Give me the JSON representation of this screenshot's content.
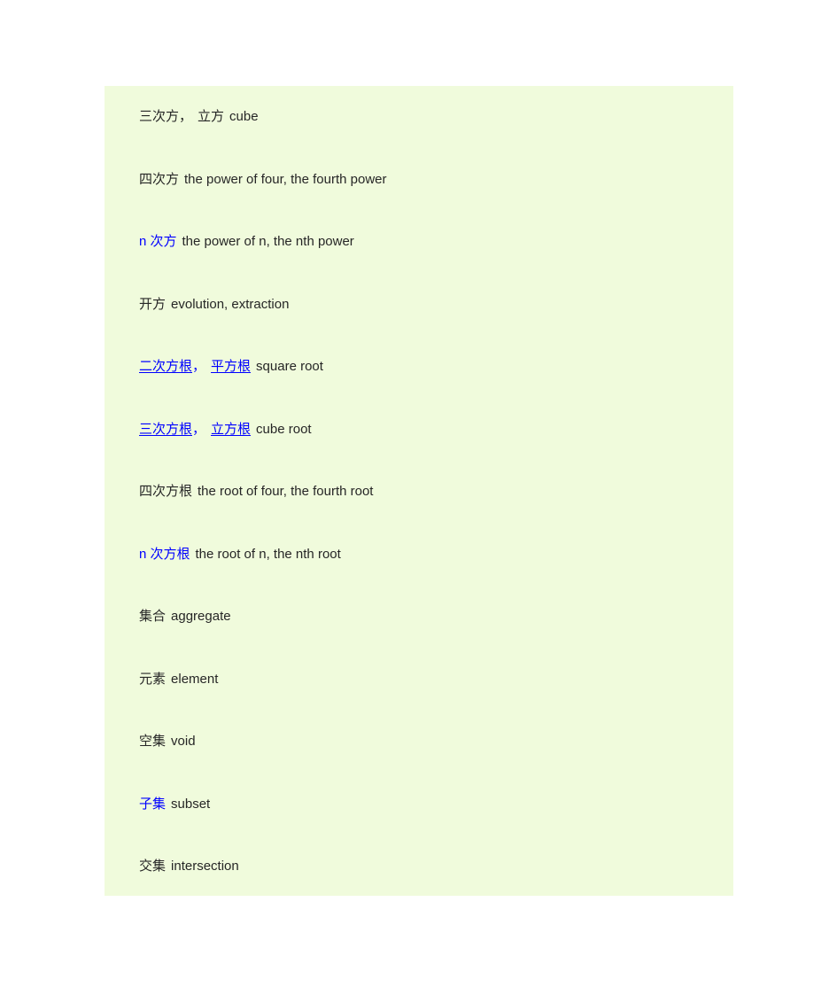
{
  "page": {
    "background_color": "#ffffff",
    "panel_background_color": "#f0fbdc",
    "text_color": "#262626",
    "link_color": "#0000ff"
  },
  "entries": [
    {
      "terms": [
        {
          "text": "三次方",
          "style": "plain"
        },
        {
          "text": "立方",
          "style": "plain"
        }
      ],
      "separator": "，",
      "separator_style": "plain",
      "definition": "cube"
    },
    {
      "terms": [
        {
          "text": "四次方",
          "style": "plain"
        }
      ],
      "separator": "",
      "separator_style": "plain",
      "definition": "the power of four, the fourth power"
    },
    {
      "terms": [
        {
          "text": "n 次方",
          "style": "blue"
        }
      ],
      "separator": "",
      "separator_style": "plain",
      "definition": "the power of n, the nth power"
    },
    {
      "terms": [
        {
          "text": "开方",
          "style": "plain"
        }
      ],
      "separator": "",
      "separator_style": "plain",
      "definition": "evolution, extraction"
    },
    {
      "terms": [
        {
          "text": "二次方根",
          "style": "link"
        },
        {
          "text": "平方根",
          "style": "link"
        }
      ],
      "separator": "，",
      "separator_style": "blue",
      "definition": "square root"
    },
    {
      "terms": [
        {
          "text": "三次方根",
          "style": "link"
        },
        {
          "text": "立方根",
          "style": "link"
        }
      ],
      "separator": "，",
      "separator_style": "blue",
      "definition": "cube root"
    },
    {
      "terms": [
        {
          "text": "四次方根",
          "style": "plain"
        }
      ],
      "separator": "",
      "separator_style": "plain",
      "definition": "the root of four, the fourth root"
    },
    {
      "terms": [
        {
          "text": "n 次方根",
          "style": "blue"
        }
      ],
      "separator": "",
      "separator_style": "plain",
      "definition": "the root of n, the nth root"
    },
    {
      "terms": [
        {
          "text": "集合",
          "style": "plain"
        }
      ],
      "separator": "",
      "separator_style": "plain",
      "definition": "aggregate"
    },
    {
      "terms": [
        {
          "text": "元素",
          "style": "plain"
        }
      ],
      "separator": "",
      "separator_style": "plain",
      "definition": "element"
    },
    {
      "terms": [
        {
          "text": "空集",
          "style": "plain"
        }
      ],
      "separator": "",
      "separator_style": "plain",
      "definition": "void"
    },
    {
      "terms": [
        {
          "text": "子集",
          "style": "blue"
        }
      ],
      "separator": "",
      "separator_style": "plain",
      "definition": "subset"
    },
    {
      "terms": [
        {
          "text": "交集",
          "style": "plain"
        }
      ],
      "separator": "",
      "separator_style": "plain",
      "definition": "intersection"
    }
  ]
}
